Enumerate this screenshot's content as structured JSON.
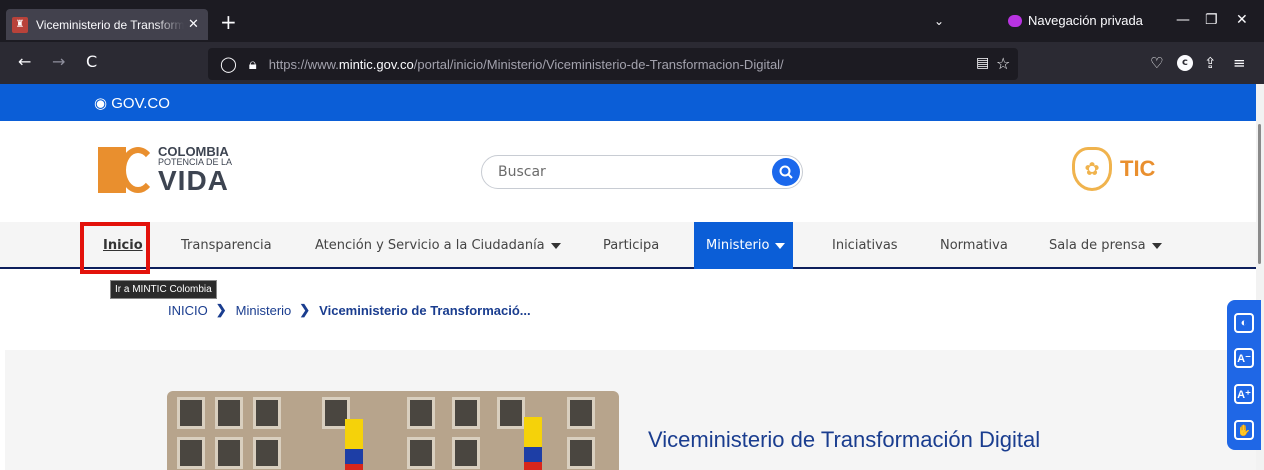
{
  "browser": {
    "tab_title": "Viceministerio de Transformación Digital",
    "tab_close": "✕",
    "new_tab": "+",
    "list_tabs": "⌄",
    "private_label": "Navegación privada",
    "minimize": "—",
    "restore": "❐",
    "close": "✕",
    "back": "←",
    "forward": "→",
    "reload": "C",
    "url_prefix": "https://www.",
    "url_domain": "mintic.gov.co",
    "url_path": "/portal/inicio/Ministerio/Viceministerio-de-Transformacion-Digital/",
    "reader_icon": "▤",
    "bookmark_icon": "☆",
    "pocket_icon": "♡",
    "account_initial": "c",
    "extensions_icon": "⇪",
    "menu_icon": "≡"
  },
  "gov_bar": {
    "label": "GOV.CO",
    "icon": "◉"
  },
  "logo": {
    "line1": "COLOMBIA",
    "line2": "POTENCIA DE LA",
    "line3": "VIDA"
  },
  "search": {
    "placeholder": "Buscar"
  },
  "mintic": {
    "label": "TIC"
  },
  "menu": {
    "items": [
      {
        "label": "Inicio"
      },
      {
        "label": "Transparencia"
      },
      {
        "label": "Atención y Servicio a la Ciudadanía",
        "dropdown": true
      },
      {
        "label": "Participa"
      },
      {
        "label": "Ministerio",
        "dropdown": true,
        "active": true
      },
      {
        "label": "Iniciativas"
      },
      {
        "label": "Normativa"
      },
      {
        "label": "Sala de prensa",
        "dropdown": true
      }
    ]
  },
  "tooltip": "Ir a MINTIC Colombia",
  "breadcrumb": {
    "items": [
      "INICIO",
      "Ministerio",
      "Viceministerio de Transformació..."
    ],
    "separator": "❯"
  },
  "hero": {
    "title": "Viceministerio de Transformación Digital"
  },
  "accessibility": {
    "contrast_icon": "contrast-icon",
    "decrease_font": "A⁻",
    "increase_font": "A⁺",
    "sign_language_icon": "sign-language-icon"
  },
  "colors": {
    "gov_blue": "#0b5ed7",
    "brand_orange": "#e98f2e",
    "navy": "#1a3d8f",
    "highlight_red": "#e3120b"
  }
}
